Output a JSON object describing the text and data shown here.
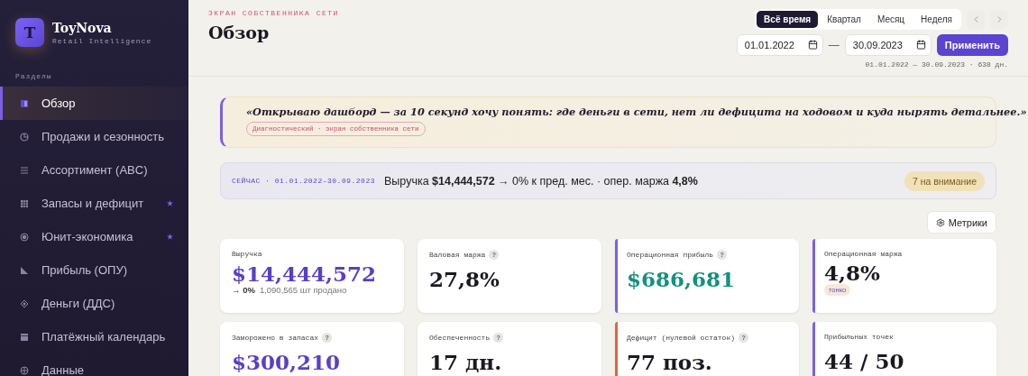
{
  "sidebar": {
    "brand": {
      "logo_letter": "T",
      "name": "ToyNova",
      "tagline": "Retail Intelligence"
    },
    "section_label": "Разделы",
    "items": [
      {
        "label": "Обзор",
        "selected": true,
        "starred": false
      },
      {
        "label": "Продажи и сезонность",
        "selected": false,
        "starred": false
      },
      {
        "label": "Ассортимент (ABC)",
        "selected": false,
        "starred": false
      },
      {
        "label": "Запасы и дефицит",
        "selected": false,
        "starred": true
      },
      {
        "label": "Юнит-экономика",
        "selected": false,
        "starred": true
      },
      {
        "label": "Прибыль (ОПУ)",
        "selected": false,
        "starred": false
      },
      {
        "label": "Деньги (ДДС)",
        "selected": false,
        "starred": false
      },
      {
        "label": "Платёжный календарь",
        "selected": false,
        "starred": false
      },
      {
        "label": "Данные",
        "selected": false,
        "starred": false
      }
    ]
  },
  "header": {
    "eyebrow": "ЭКРАН СОБСТВЕННИКА СЕТИ",
    "title": "Обзор",
    "periods": [
      {
        "label": "Всё время",
        "selected": true
      },
      {
        "label": "Квартал",
        "selected": false
      },
      {
        "label": "Месяц",
        "selected": false
      },
      {
        "label": "Неделя",
        "selected": false
      }
    ],
    "date_from": "01.01.2022",
    "date_separator": "—",
    "date_to": "30.09.2023",
    "apply_button": "Применить",
    "range_text": "01.01.2022 — 30.09.2023 · 638 дн."
  },
  "quote": {
    "text": "«Открываю дашборд — за 10 секунд хочу понять: где деньги в сети, нет ли дефицита на ходовом и куда нырять детальнее.»",
    "tag": "Диагностический · экран собственника сети"
  },
  "now_bar": {
    "label": "СЕЙЧАС · 01.01.2022–30.09.2023",
    "summary": "Выручка **$14,444,572** → 0% к пред. мес. · опер. маржа **4,8%**",
    "badge": "7 на внимание"
  },
  "metrics_button": "Метрики",
  "kpis": [
    {
      "label": "Выручка",
      "value": "$14,444,572",
      "kind": "amount",
      "trend": "→ 0%",
      "note": "1,090,565 шт продано"
    },
    {
      "label": "Валовая маржа",
      "help": "?",
      "value": "27,8%",
      "kind": "plain"
    },
    {
      "label": "Операционная прибыль",
      "help": "?",
      "value": "$686,681",
      "kind": "profit",
      "color": "#7b5fe8"
    },
    {
      "label": "Операционная маржа",
      "value": "4,8%",
      "kind": "plain",
      "color": "#7b5fe8",
      "badge": "тонко"
    },
    {
      "label": "Заморожено в запасах",
      "help": "?",
      "value": "$300,210",
      "kind": "amount"
    },
    {
      "label": "Обеспеченность",
      "help": "?",
      "value": "17 дн.",
      "kind": "plain"
    },
    {
      "label": "Дефицит (нулевой остаток)",
      "help": "?",
      "value": "77 поз.",
      "kind": "plain",
      "color": "#e0663e"
    },
    {
      "label": "Прибыльных точек",
      "value": "44 / 50",
      "kind": "plain",
      "color": "#7b5fe8"
    }
  ]
}
